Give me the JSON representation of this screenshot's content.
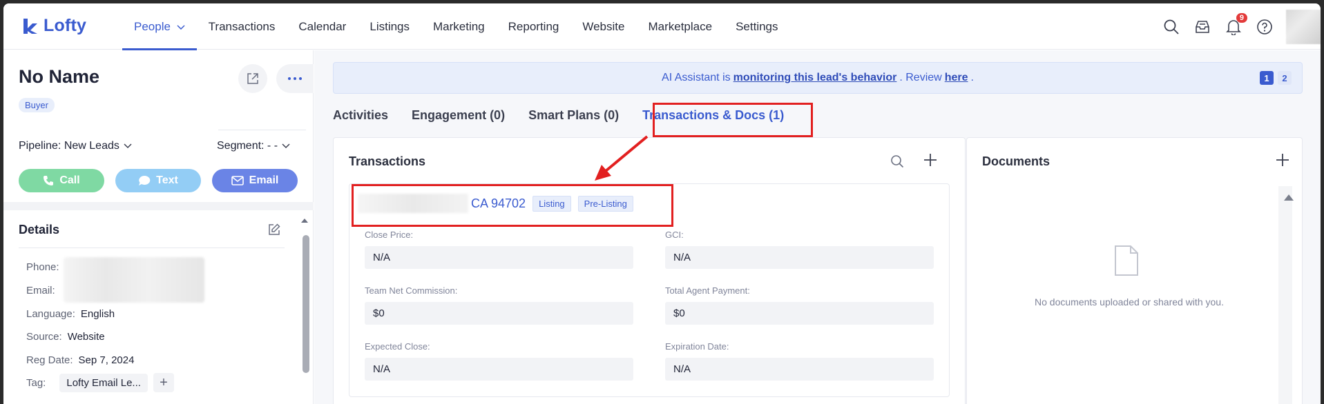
{
  "app": {
    "name": "Lofty"
  },
  "nav": {
    "items": [
      {
        "label": "People",
        "active": true,
        "has_dropdown": true
      },
      {
        "label": "Transactions"
      },
      {
        "label": "Calendar"
      },
      {
        "label": "Listings"
      },
      {
        "label": "Marketing"
      },
      {
        "label": "Reporting"
      },
      {
        "label": "Website"
      },
      {
        "label": "Marketplace"
      },
      {
        "label": "Settings"
      }
    ],
    "notification_count": "9"
  },
  "lead": {
    "name": "No Name",
    "type_tag": "Buyer",
    "pipeline": "Pipeline: New Leads",
    "segment": "Segment: - -",
    "actions": {
      "call": "Call",
      "text": "Text",
      "email": "Email"
    }
  },
  "details": {
    "title": "Details",
    "phone_label": "Phone:",
    "email_label": "Email:",
    "language_label": "Language:",
    "language_value": "English",
    "source_label": "Source:",
    "source_value": "Website",
    "reg_date_label": "Reg Date:",
    "reg_date_value": "Sep 7, 2024",
    "tag_label": "Tag:",
    "tag_value": "Lofty Email Le..."
  },
  "ai_banner": {
    "prefix": "AI Assistant is",
    "link": "monitoring this lead's behavior",
    "middle": ". Review",
    "here": "here",
    "suffix": ".",
    "pages": [
      "1",
      "2"
    ]
  },
  "tabs": [
    {
      "label": "Activities"
    },
    {
      "label": "Engagement (0)"
    },
    {
      "label": "Smart Plans (0)"
    },
    {
      "label": "Transactions & Docs (1)",
      "active": true
    }
  ],
  "transactions": {
    "title": "Transactions",
    "address": "CA 94702",
    "chips": [
      "Listing",
      "Pre-Listing"
    ],
    "fields": {
      "close_price_label": "Close Price:",
      "close_price": "N/A",
      "gci_label": "GCI:",
      "gci": "N/A",
      "team_net_label": "Team Net Commission:",
      "team_net": "$0",
      "total_agent_label": "Total Agent Payment:",
      "total_agent": "$0",
      "expected_close_label": "Expected Close:",
      "expected_close": "N/A",
      "expiration_label": "Expiration Date:",
      "expiration": "N/A"
    }
  },
  "documents": {
    "title": "Documents",
    "empty_text": "No documents uploaded or shared with you."
  },
  "colors": {
    "brand": "#3a5bcf",
    "highlight": "#e22020",
    "call": "#7fd9a3",
    "text": "#93cdf5",
    "email": "#6a84e6"
  }
}
